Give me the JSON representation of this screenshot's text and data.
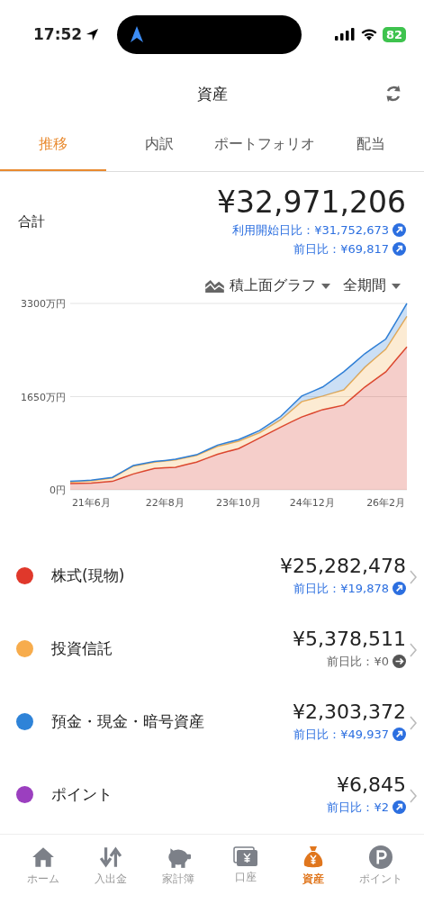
{
  "status_bar": {
    "time": "17:52",
    "battery": "82"
  },
  "header": {
    "title": "資産"
  },
  "tabs": [
    {
      "label": "推移",
      "selected": true
    },
    {
      "label": "内訳",
      "selected": false
    },
    {
      "label": "ポートフォリオ",
      "selected": false
    },
    {
      "label": "配当",
      "selected": false
    }
  ],
  "total": {
    "label": "合計",
    "amount": "¥32,971,206",
    "changes": [
      {
        "text": "利用開始日比：¥31,752,673",
        "kind": "up"
      },
      {
        "text": "前日比：¥69,817",
        "kind": "up"
      }
    ]
  },
  "chart_controls": {
    "chart_type": "積上面グラフ",
    "period": "全期間"
  },
  "chart_data": {
    "type": "area",
    "stacked": true,
    "categories": [
      null,
      null,
      "21年6月",
      null,
      null,
      null,
      null,
      null,
      null,
      "22年8月",
      null,
      null,
      null,
      null,
      null,
      null,
      "23年10月",
      null,
      null,
      null,
      null,
      null,
      null,
      "24年12月",
      null,
      null,
      null,
      null,
      null,
      null,
      "26年2月",
      null,
      null
    ],
    "ylim": [
      0,
      3300
    ],
    "yticks": [
      {
        "value": 0,
        "label": "0円"
      },
      {
        "value": 1650,
        "label": "1650万円"
      },
      {
        "value": 3300,
        "label": "3300万円"
      }
    ],
    "series": [
      {
        "color": "#d93a2b",
        "values": [
          110,
          115,
          120,
          135,
          150,
          215,
          280,
          330,
          380,
          390,
          400,
          445,
          490,
          560,
          630,
          680,
          730,
          825,
          920,
          1015,
          1110,
          1200,
          1290,
          1355,
          1420,
          1460,
          1500,
          1660,
          1820,
          1955,
          2090,
          2310,
          2530
        ]
      },
      {
        "color": "#f5b04f",
        "values": [
          30,
          35,
          40,
          50,
          60,
          100,
          140,
          125,
          110,
          120,
          130,
          125,
          120,
          130,
          140,
          135,
          130,
          110,
          90,
          110,
          130,
          200,
          270,
          255,
          240,
          255,
          270,
          310,
          350,
          375,
          400,
          470,
          540
        ]
      },
      {
        "color": "#2f7fd6",
        "values": [
          10,
          10,
          10,
          10,
          10,
          10,
          10,
          10,
          10,
          10,
          10,
          10,
          10,
          15,
          20,
          25,
          30,
          35,
          40,
          50,
          60,
          80,
          100,
          130,
          160,
          240,
          320,
          280,
          240,
          210,
          180,
          205,
          230
        ]
      }
    ]
  },
  "assets": [
    {
      "name": "株式(現物)",
      "color": "#e0382b",
      "amount": "¥25,282,478",
      "change": "前日比：¥19,878",
      "kind": "up"
    },
    {
      "name": "投資信託",
      "color": "#f7ac4c",
      "amount": "¥5,378,511",
      "change": "前日比：¥0",
      "kind": "flat"
    },
    {
      "name": "預金・現金・暗号資産",
      "color": "#2e83d8",
      "amount": "¥2,303,372",
      "change": "前日比：¥49,937",
      "kind": "up"
    },
    {
      "name": "ポイント",
      "color": "#9b3fbf",
      "amount": "¥6,845",
      "change": "前日比：¥2",
      "kind": "up"
    }
  ],
  "bottom_nav": [
    {
      "label": "ホーム",
      "kind": "home",
      "selected": false
    },
    {
      "label": "入出金",
      "kind": "transfer",
      "selected": false
    },
    {
      "label": "家計簿",
      "kind": "piggy",
      "selected": false
    },
    {
      "label": "口座",
      "kind": "account",
      "selected": false
    },
    {
      "label": "資産",
      "kind": "bag",
      "selected": true
    },
    {
      "label": "ポイント",
      "kind": "point",
      "selected": false
    }
  ]
}
